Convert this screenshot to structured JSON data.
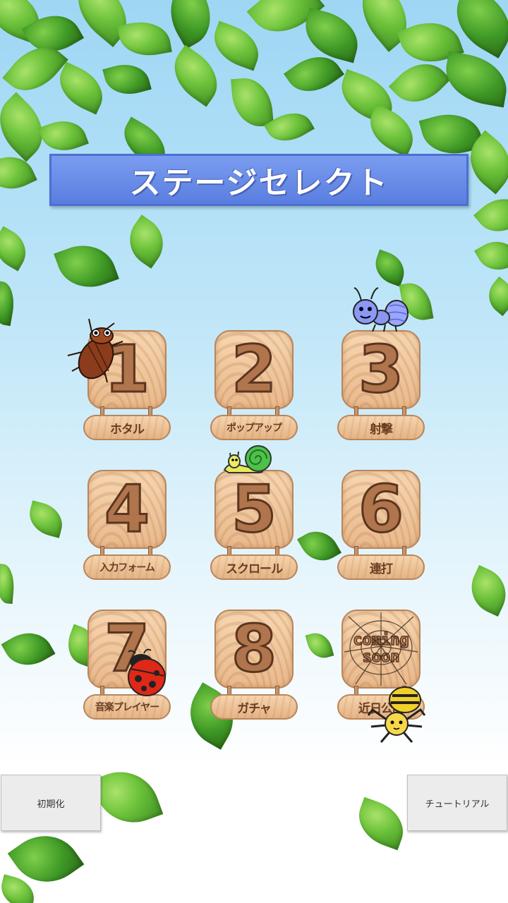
{
  "title": "ステージセレクト",
  "stages": [
    {
      "number": "1",
      "label": "ホタル"
    },
    {
      "number": "2",
      "label": "ポップアップ"
    },
    {
      "number": "3",
      "label": "射撃"
    },
    {
      "number": "4",
      "label": "入力フォーム"
    },
    {
      "number": "5",
      "label": "スクロール"
    },
    {
      "number": "6",
      "label": "連打"
    },
    {
      "number": "7",
      "label": "音楽プレイヤー"
    },
    {
      "number": "8",
      "label": "ガチャ"
    },
    {
      "coming_line1": "coming",
      "coming_line2": "soon",
      "label": "近日公開"
    }
  ],
  "buttons": {
    "reset": "初期化",
    "tutorial": "チュートリアル"
  },
  "icons": {
    "stage1_bug": "cicada-icon",
    "stage3_bug": "caterpillar-icon",
    "stage5_bug": "snail-icon",
    "stage7_bug": "ladybug-icon",
    "stage9_bug": "spider-icon"
  },
  "colors": {
    "title_banner": "#6a8de8",
    "wood": "#f0c8a0",
    "wood_text": "#5a3520",
    "leaf": "#6cc23a"
  }
}
